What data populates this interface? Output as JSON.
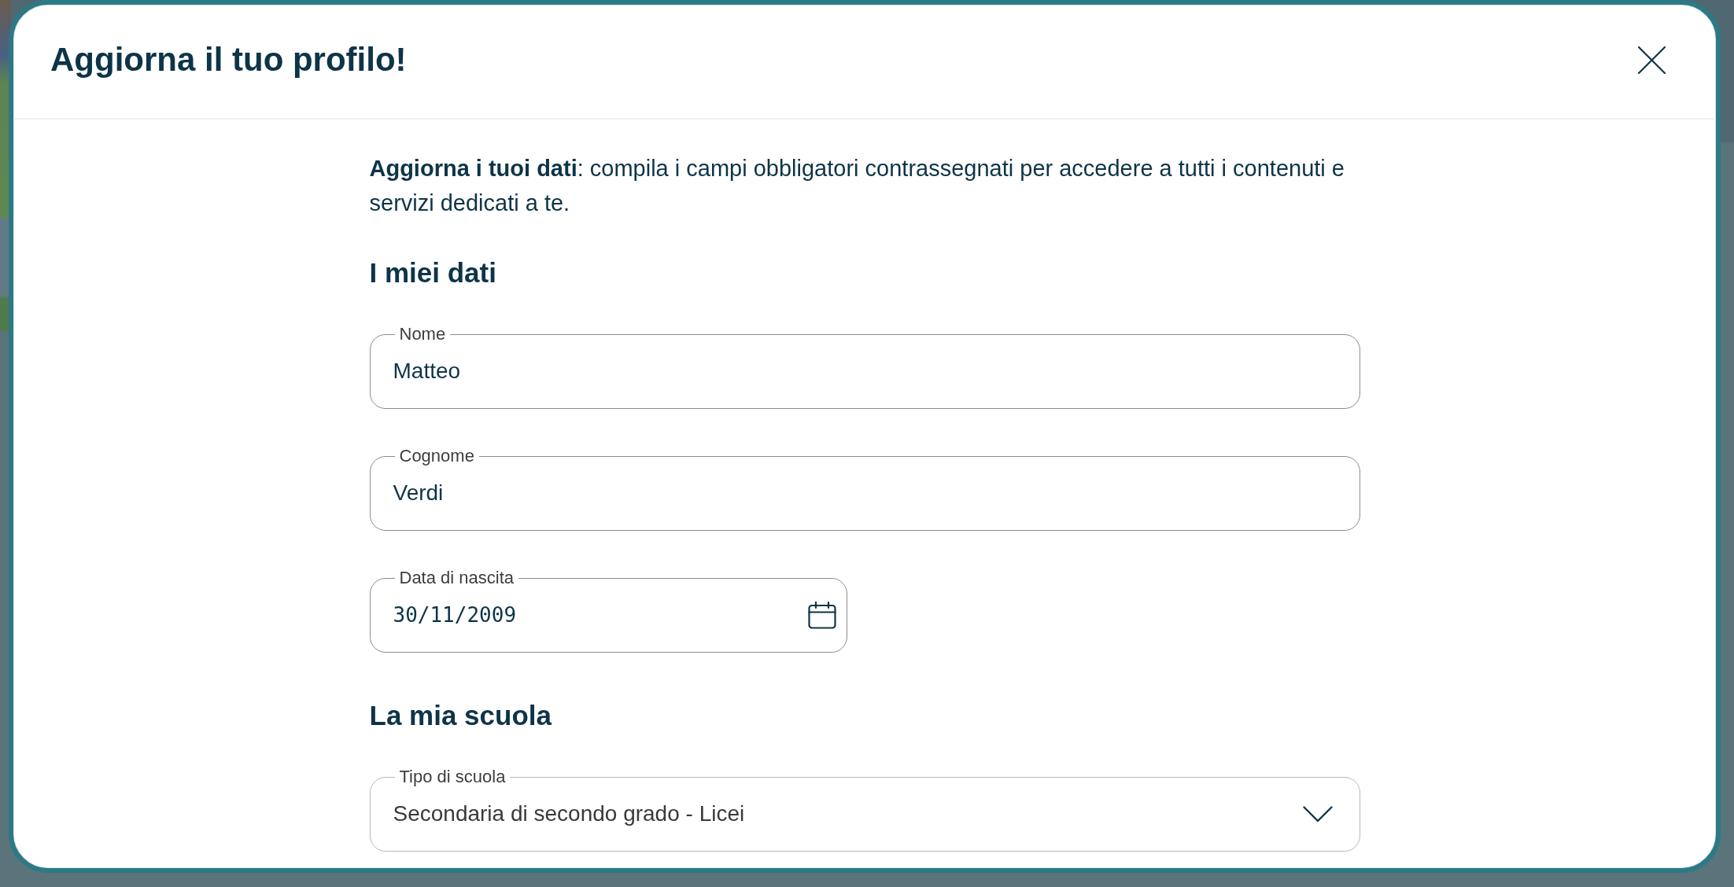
{
  "dialog": {
    "title": "Aggiorna il tuo profilo!"
  },
  "intro": "**Aggiorna i tuoi dati**: compila i campi obbligatori contrassegnati per accedere a tutti i contenuti e servizi dedicati a te.",
  "sections": [
    {
      "heading": "I miei dati",
      "fields": [
        {
          "kind": "text",
          "label": "Nome",
          "value": "Matteo"
        },
        {
          "kind": "text",
          "label": "Cognome",
          "value": "Verdi"
        },
        {
          "kind": "date",
          "label": "Data di nascita",
          "value": "30/11/2009"
        }
      ]
    },
    {
      "heading": "La mia scuola",
      "fields": [
        {
          "kind": "select",
          "label": "Tipo di scuola",
          "value": "Secondaria di secondo grado - Licei"
        }
      ]
    }
  ]
}
